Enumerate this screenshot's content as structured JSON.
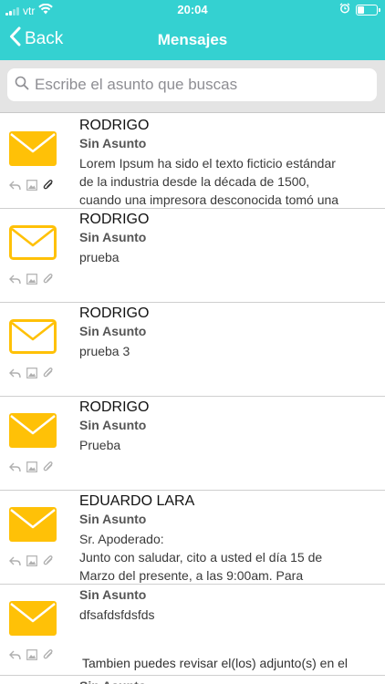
{
  "status_bar": {
    "carrier": "vtr",
    "time": "20:04"
  },
  "nav": {
    "back_label": "Back",
    "title": "Mensajes"
  },
  "search": {
    "placeholder": "Escribe el asunto que buscas"
  },
  "colors": {
    "header": "#34d1d1",
    "envelope": "#ffc107",
    "icon_gray": "#b0b0b0"
  },
  "messages": [
    {
      "sender": "RODRIGO",
      "subject": "Sin Asunto",
      "preview_lines": [
        "Lorem Ipsum ha sido el texto ficticio estándar",
        "de la industria desde la década de 1500,",
        "cuando una impresora desconocida tomó una"
      ],
      "envelope": "filled",
      "has_attachment": true
    },
    {
      "sender": "RODRIGO",
      "subject": "Sin Asunto",
      "preview_lines": [
        "prueba"
      ],
      "envelope": "outline",
      "has_attachment": false
    },
    {
      "sender": "RODRIGO",
      "subject": "Sin Asunto",
      "preview_lines": [
        "prueba 3"
      ],
      "envelope": "outline",
      "has_attachment": false
    },
    {
      "sender": "RODRIGO",
      "subject": "Sin Asunto",
      "preview_lines": [
        "Prueba"
      ],
      "envelope": "filled",
      "has_attachment": false
    },
    {
      "sender": "EDUARDO LARA",
      "subject": "Sin Asunto",
      "preview_lines": [
        "Sr. Apoderado:",
        "Junto con saludar, cito a usted el día 15 de",
        "Marzo del presente, a las 9:00am. Para"
      ],
      "envelope": "filled",
      "has_attachment": false
    },
    {
      "sender": "",
      "subject": "Sin Asunto",
      "preview_lines": [
        "dfsafdsfdsfds"
      ],
      "envelope": "filled",
      "has_attachment": false
    }
  ],
  "footnote": "Tambien puedes revisar el(los) adjunto(s) en el",
  "partial_next": "Sin Asunto"
}
